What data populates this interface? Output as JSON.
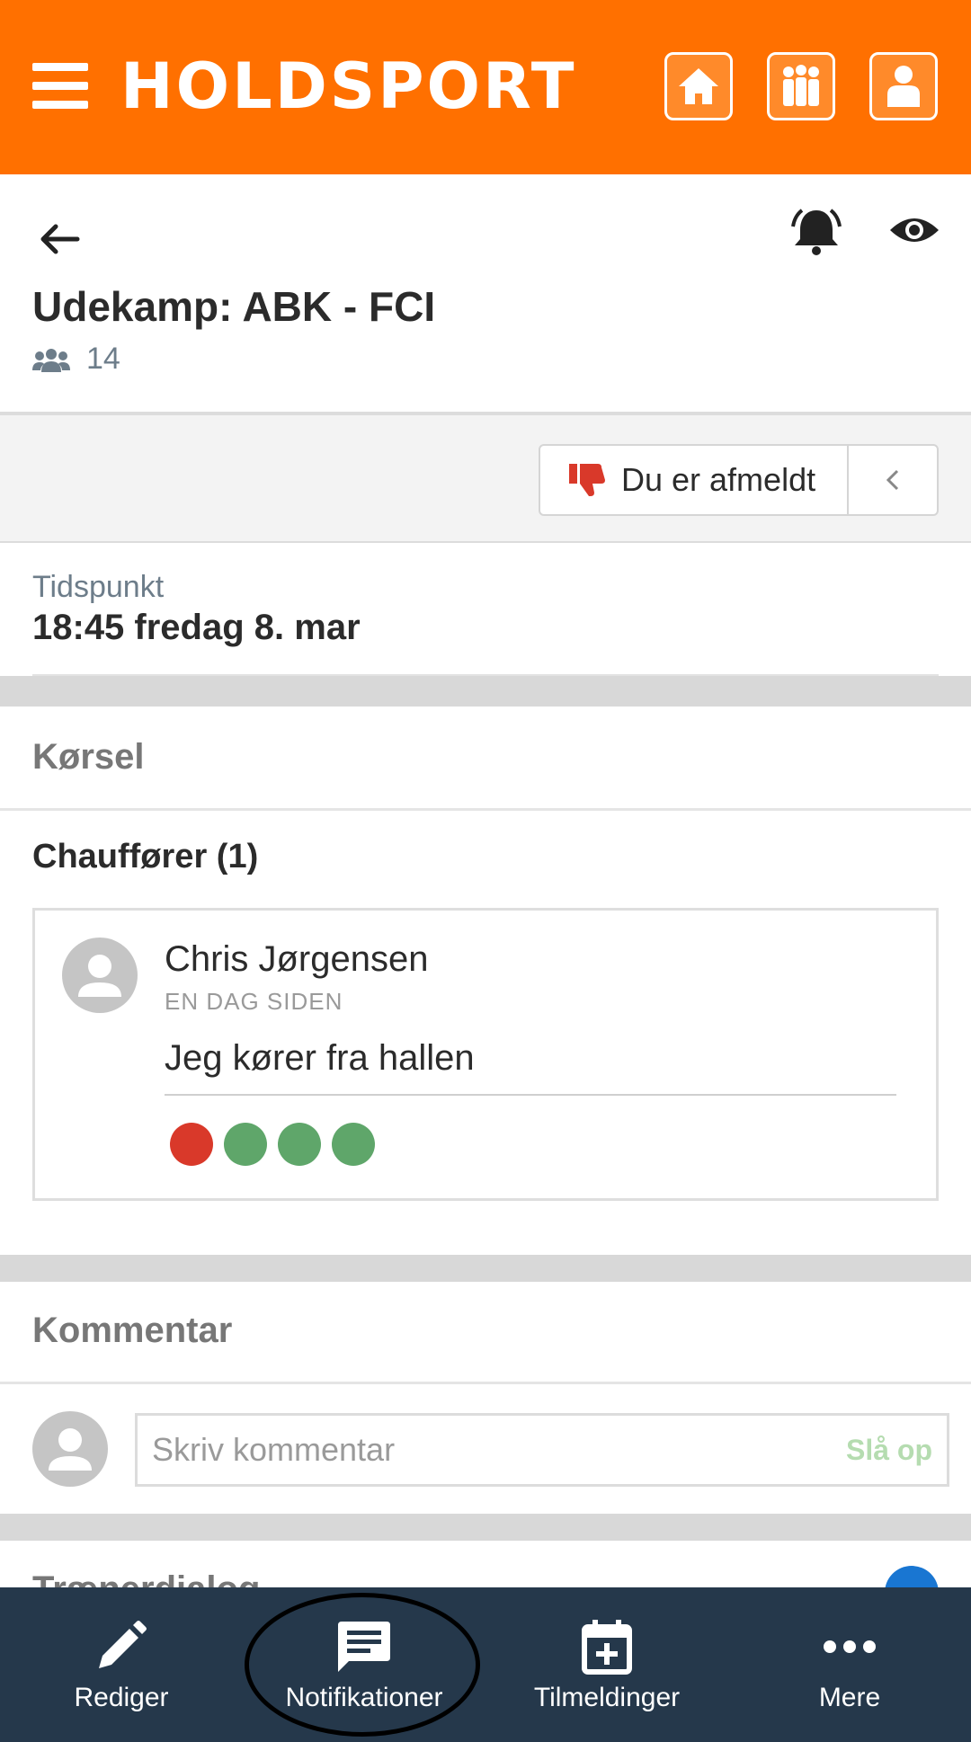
{
  "app": {
    "logo": "HOLDSPORT",
    "brand_color": "#ff7000",
    "nav_color": "#25384b"
  },
  "topbar": {
    "menu_icon": "hamburger-icon",
    "buttons": [
      {
        "icon": "home-icon"
      },
      {
        "icon": "team-icon"
      },
      {
        "icon": "profile-icon"
      }
    ]
  },
  "event": {
    "title": "Udekamp: ABK - FCI",
    "participants": "14",
    "status_label": "Du er afmeldt",
    "time_label": "Tidspunkt",
    "time_value": "18:45 fredag 8. mar"
  },
  "driving": {
    "section_title": "Kørsel",
    "drivers_title": "Chauffører (1)",
    "drivers": [
      {
        "name": "Chris Jørgensen",
        "when": "EN DAG SIDEN",
        "note": "Jeg kører fra hallen",
        "seats": [
          "taken",
          "free",
          "free",
          "free"
        ]
      }
    ]
  },
  "comments": {
    "section_title": "Kommentar",
    "placeholder": "Skriv kommentar",
    "lookup_label": "Slå op"
  },
  "next_section": {
    "title": "Trænerdialog"
  },
  "bottom_nav": [
    {
      "label": "Rediger",
      "icon": "pencil-icon"
    },
    {
      "label": "Notifikationer",
      "icon": "message-icon"
    },
    {
      "label": "Tilmeldinger",
      "icon": "calendar-plus-icon"
    },
    {
      "label": "Mere",
      "icon": "more-icon"
    }
  ]
}
